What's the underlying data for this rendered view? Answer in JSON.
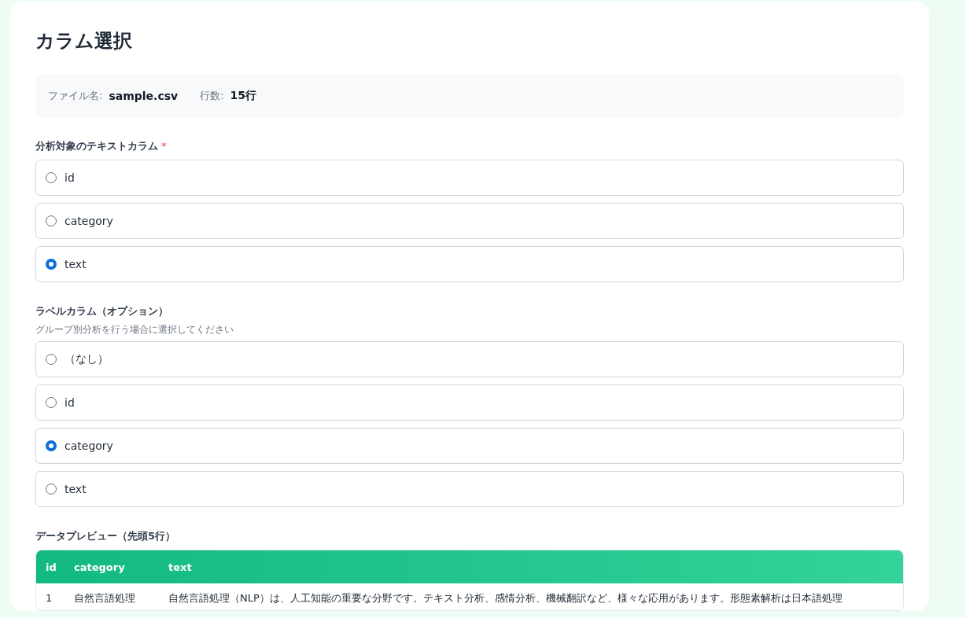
{
  "title": "カラム選択",
  "file_info": [
    {
      "label": "ファイル名:",
      "value": "sample.csv"
    },
    {
      "label": "行数:",
      "value": "15行"
    }
  ],
  "text_column": {
    "label": "分析対象のテキストカラム",
    "required_mark": "*",
    "options": [
      {
        "label": "id",
        "selected": false
      },
      {
        "label": "category",
        "selected": false
      },
      {
        "label": "text",
        "selected": true
      }
    ]
  },
  "label_column": {
    "label": "ラベルカラム（オプション）",
    "hint": "グループ別分析を行う場合に選択してください",
    "options": [
      {
        "label": "（なし）",
        "selected": false
      },
      {
        "label": "id",
        "selected": false
      },
      {
        "label": "category",
        "selected": true
      },
      {
        "label": "text",
        "selected": false
      }
    ]
  },
  "preview": {
    "title": "データプレビュー（先頭5行）",
    "columns": [
      "id",
      "category",
      "text"
    ],
    "rows": [
      [
        "1",
        "自然言語処理",
        "自然言語処理（NLP）は、人工知能の重要な分野です。テキスト分析、感情分析、機械翻訳など、様々な応用があります。形態素解析は日本語処理"
      ]
    ]
  }
}
